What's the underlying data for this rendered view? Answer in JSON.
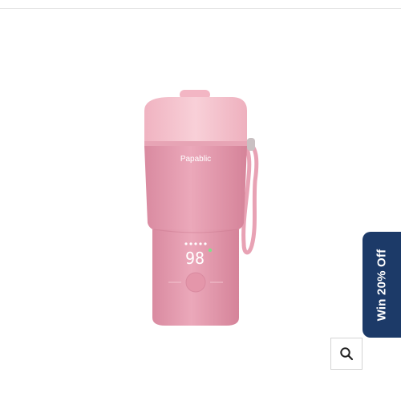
{
  "product": {
    "brand_logo_text": "Papablic",
    "display_temperature": "98"
  },
  "promo": {
    "label": "Win 20% Off"
  },
  "zoom": {
    "icon": "search-icon"
  },
  "colors": {
    "promo_background": "#1c3a68",
    "product_body": "#e59fb3",
    "product_lid": "#f5c3ce"
  }
}
